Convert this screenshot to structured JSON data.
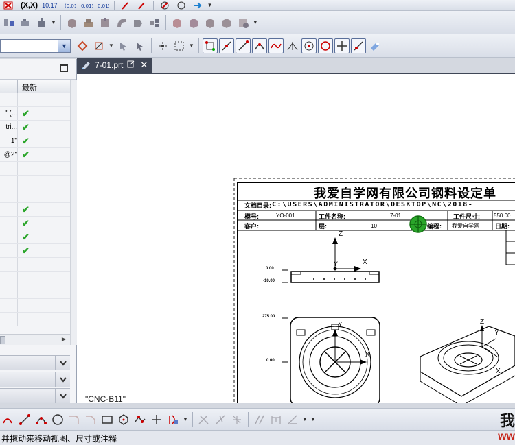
{
  "toolbar_top": {
    "row1_labels": [
      "(X,X)",
      "10.17",
      "10.015"
    ]
  },
  "tab": {
    "label": "7-01.prt"
  },
  "navigator": {
    "column_latest": "最新",
    "rows": [
      {
        "name": "",
        "latest": ""
      },
      {
        "name": "\" (...",
        "latest": "✔"
      },
      {
        "name": "tri...",
        "latest": "✔"
      },
      {
        "name": "1\"",
        "latest": "✔"
      },
      {
        "name": "@2\"",
        "latest": "✔"
      },
      {
        "name": "",
        "latest": ""
      },
      {
        "name": "",
        "latest": ""
      },
      {
        "name": "",
        "latest": ""
      },
      {
        "name": "",
        "latest": "✔"
      },
      {
        "name": "",
        "latest": "✔"
      },
      {
        "name": "",
        "latest": "✔"
      },
      {
        "name": "",
        "latest": "✔"
      },
      {
        "name": "",
        "latest": ""
      },
      {
        "name": "",
        "latest": ""
      },
      {
        "name": "",
        "latest": ""
      },
      {
        "name": "",
        "latest": ""
      },
      {
        "name": "",
        "latest": ""
      }
    ]
  },
  "drawing": {
    "title": "我爱自学网有限公司钢料设定单",
    "path_label": "文档目录:",
    "path": "C:\\USERS\\ADMINISTRATOR\\DESKTOP\\NC\\2018-",
    "mold_no_label": "模号:",
    "mold_no": "YO-001",
    "part_name_label": "工件名称:",
    "part_name": "7-01",
    "part_size_label": "工件尺寸:",
    "part_size": "550.00",
    "customer_label": "客户:",
    "layer_label": "层:",
    "layer_value": "10",
    "programmer_label": "编程:",
    "programmer_value": "我爱自学网",
    "date_label": "日期:",
    "axis_z": "Z",
    "axis_y": "Y",
    "axis_x": "X",
    "dim_top_a": "0.00",
    "dim_top_b": "-10.00",
    "dim_mid": "275.00",
    "dim_bottom": "0.00",
    "iso_z": "Z",
    "iso_y": "Y",
    "iso_x": "X"
  },
  "canvas_note": "\"CNC-B11\"",
  "status": {
    "message": "并拖动来移动视图、尺寸或注释"
  },
  "watermark": {
    "char": "我",
    "text": "ww"
  },
  "colors": {
    "accent_green": "#2aa52a",
    "tab_bg": "#3f4656"
  }
}
